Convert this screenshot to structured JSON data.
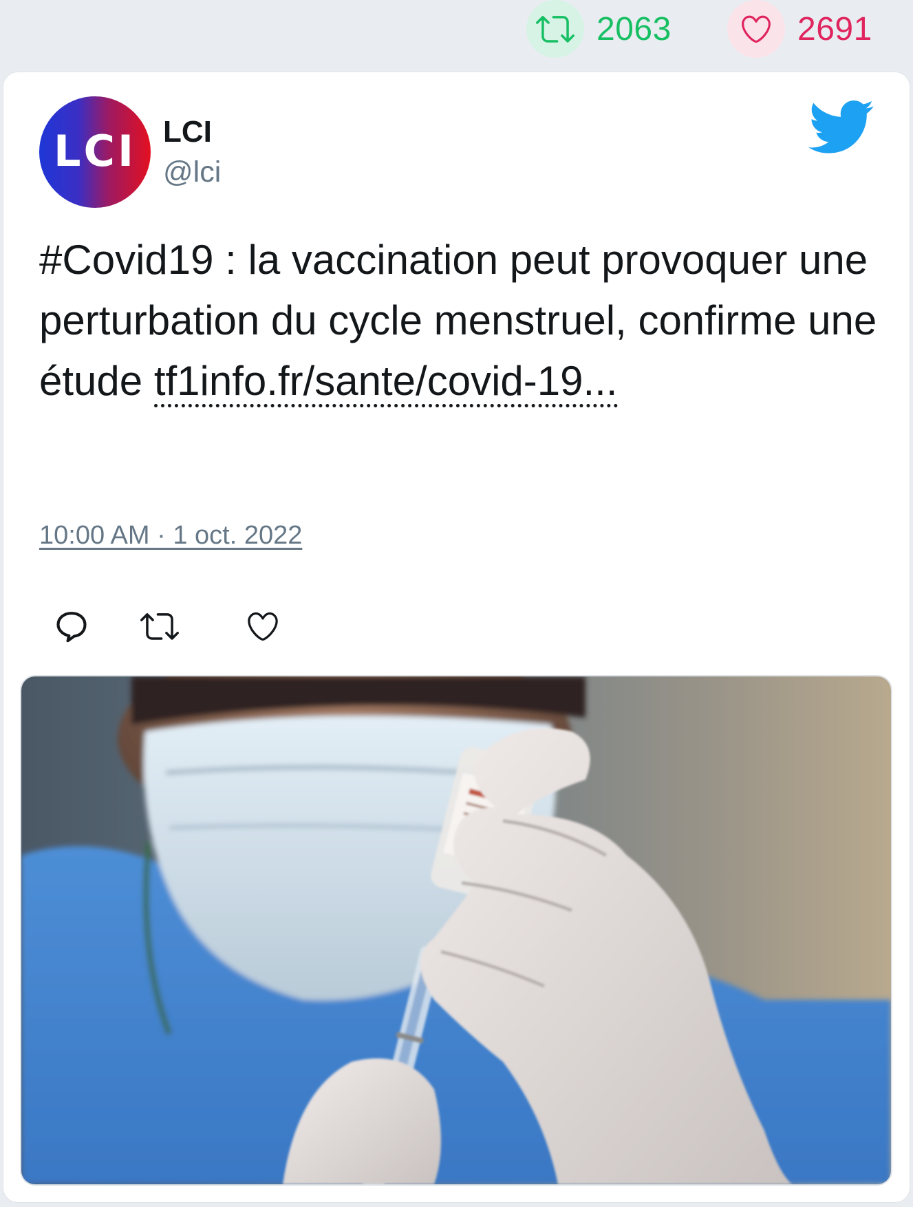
{
  "stats": {
    "retweets": "2063",
    "likes": "2691",
    "retweet_icon": "retweet-icon",
    "like_icon": "heart-icon",
    "retweet_color": "#17bf63",
    "like_color": "#e0245e"
  },
  "tweet": {
    "author_name": "LCI",
    "author_handle": "@lci",
    "avatar_text": "LCI",
    "text": "#Covid19 : la vaccination peut provoquer une perturbation du cycle menstruel, confirme une étude ",
    "link_text": "tf1info.fr/sante/covid-19...",
    "timestamp": "10:00 AM · 1 oct. 2022",
    "brand_icon": "twitter-bird-icon",
    "brand_color": "#1da1f2"
  },
  "actions": {
    "reply_icon": "reply-icon",
    "retweet_icon": "retweet-icon",
    "like_icon": "heart-icon"
  },
  "media": {
    "kind": "photo"
  }
}
